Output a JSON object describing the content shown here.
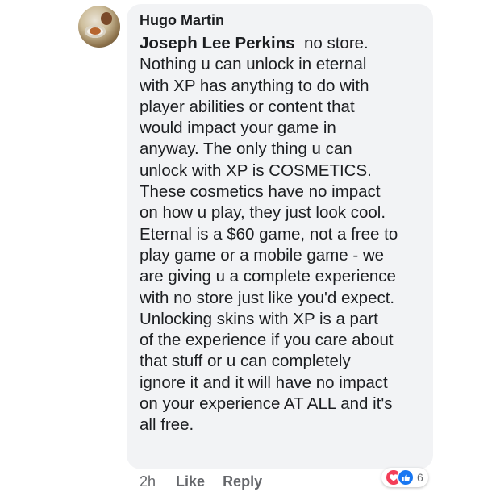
{
  "comment": {
    "author": "Hugo Martin",
    "mention": "Joseph Lee Perkins",
    "lines": [
      "no store.",
      "Nothing u can unlock in eternal",
      "with XP has anything to do with",
      "player abilities or content that",
      "would impact your game in",
      "anyway. The only thing u can",
      "unlock with XP is COSMETICS.",
      "These cosmetics have no impact",
      "on how u play, they just look cool.",
      "Eternal is a $60 game, not a free to",
      "play game or a mobile game - we",
      "are giving u a complete experience",
      "with no store just like you'd expect.",
      "Unlocking skins with XP is a part",
      "of the experience if you care about",
      "that stuff or u can completely",
      "ignore it and it will have no impact",
      "on your experience AT ALL and it's",
      "all free."
    ]
  },
  "actions": {
    "time": "2h",
    "like_label": "Like",
    "reply_label": "Reply"
  },
  "reactions": {
    "count": "6",
    "icons": [
      "love-icon",
      "like-icon"
    ],
    "love_color": "#f33e58",
    "like_color": "#1877f2"
  }
}
